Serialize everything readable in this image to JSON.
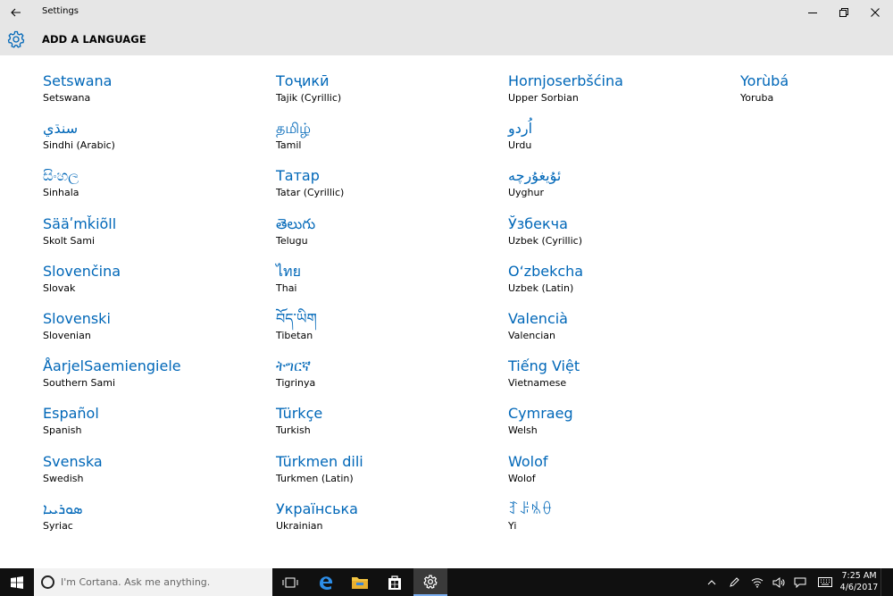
{
  "window": {
    "title": "Settings"
  },
  "header": {
    "title": "ADD A LANGUAGE"
  },
  "columns": [
    [
      {
        "native": "Setswana",
        "english": "Setswana"
      },
      {
        "native": "سنڌي",
        "english": "Sindhi (Arabic)"
      },
      {
        "native": "සිංහල",
        "english": "Sinhala"
      },
      {
        "native": "Sääʹmǩiõll",
        "english": "Skolt Sami"
      },
      {
        "native": "Slovenčina",
        "english": "Slovak"
      },
      {
        "native": "Slovenski",
        "english": "Slovenian"
      },
      {
        "native": "ÅarjelSaemiengiele",
        "english": "Southern Sami"
      },
      {
        "native": "Español",
        "english": "Spanish"
      },
      {
        "native": "Svenska",
        "english": "Swedish"
      },
      {
        "native": "ܣܘܪܝܝܐ",
        "english": "Syriac"
      }
    ],
    [
      {
        "native": "Тоҷикӣ",
        "english": "Tajik (Cyrillic)"
      },
      {
        "native": "தமிழ்",
        "english": "Tamil"
      },
      {
        "native": "Татар",
        "english": "Tatar (Cyrillic)"
      },
      {
        "native": "తెలుగు",
        "english": "Telugu"
      },
      {
        "native": "ไทย",
        "english": "Thai"
      },
      {
        "native": "བོད་ཡིག",
        "english": "Tibetan"
      },
      {
        "native": "ትግርኛ",
        "english": "Tigrinya"
      },
      {
        "native": "Türkçe",
        "english": "Turkish"
      },
      {
        "native": "Türkmen dili",
        "english": "Turkmen (Latin)"
      },
      {
        "native": "Українська",
        "english": "Ukrainian"
      }
    ],
    [
      {
        "native": "Hornjoserbšćina",
        "english": "Upper Sorbian"
      },
      {
        "native": "اُردو",
        "english": "Urdu"
      },
      {
        "native": "ئۇيغۇرچە",
        "english": "Uyghur"
      },
      {
        "native": "Ўзбекча",
        "english": "Uzbek (Cyrillic)"
      },
      {
        "native": "O‘zbekcha",
        "english": "Uzbek (Latin)"
      },
      {
        "native": "Valencià",
        "english": "Valencian"
      },
      {
        "native": "Tiếng Việt",
        "english": "Vietnamese"
      },
      {
        "native": "Cymraeg",
        "english": "Welsh"
      },
      {
        "native": "Wolof",
        "english": "Wolof"
      },
      {
        "native": "ꆈꌠꁱꂷ",
        "english": "Yi"
      }
    ],
    [
      {
        "native": "Yorùbá",
        "english": "Yoruba"
      }
    ]
  ],
  "taskbar": {
    "search_placeholder": "I'm Cortana. Ask me anything.",
    "time": "7:25 AM",
    "date": "4/6/2017",
    "icons": [
      "windows-start-icon",
      "task-view-icon",
      "edge-icon",
      "file-explorer-icon",
      "store-icon",
      "settings-icon"
    ]
  },
  "colors": {
    "accent": "#0067b8",
    "titlebar_bg": "#e6e6e6",
    "taskbar_bg": "#101010"
  }
}
